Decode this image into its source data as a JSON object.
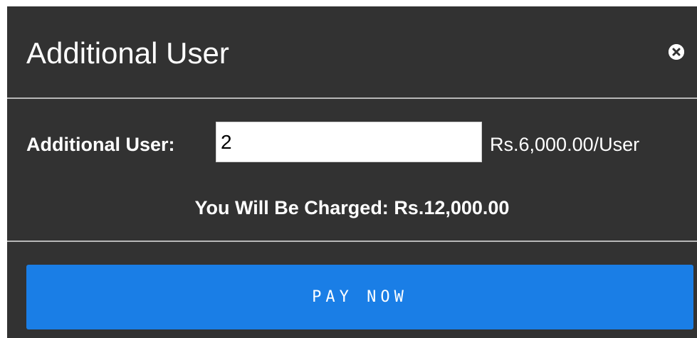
{
  "modal": {
    "title": "Additional User",
    "close_icon": "close-circle-icon"
  },
  "form": {
    "additional_user_label": "Additional User:",
    "additional_user_value": "2",
    "price_per_user": "Rs.6,000.00/User",
    "charge_label": "You Will Be Charged:",
    "charge_amount": "Rs.12,000.00"
  },
  "actions": {
    "pay_now_label": "PAY NOW"
  },
  "colors": {
    "modal_background": "#323232",
    "divider": "#b8b8b8",
    "pay_button": "#1a7ee6",
    "text": "#ffffff"
  }
}
